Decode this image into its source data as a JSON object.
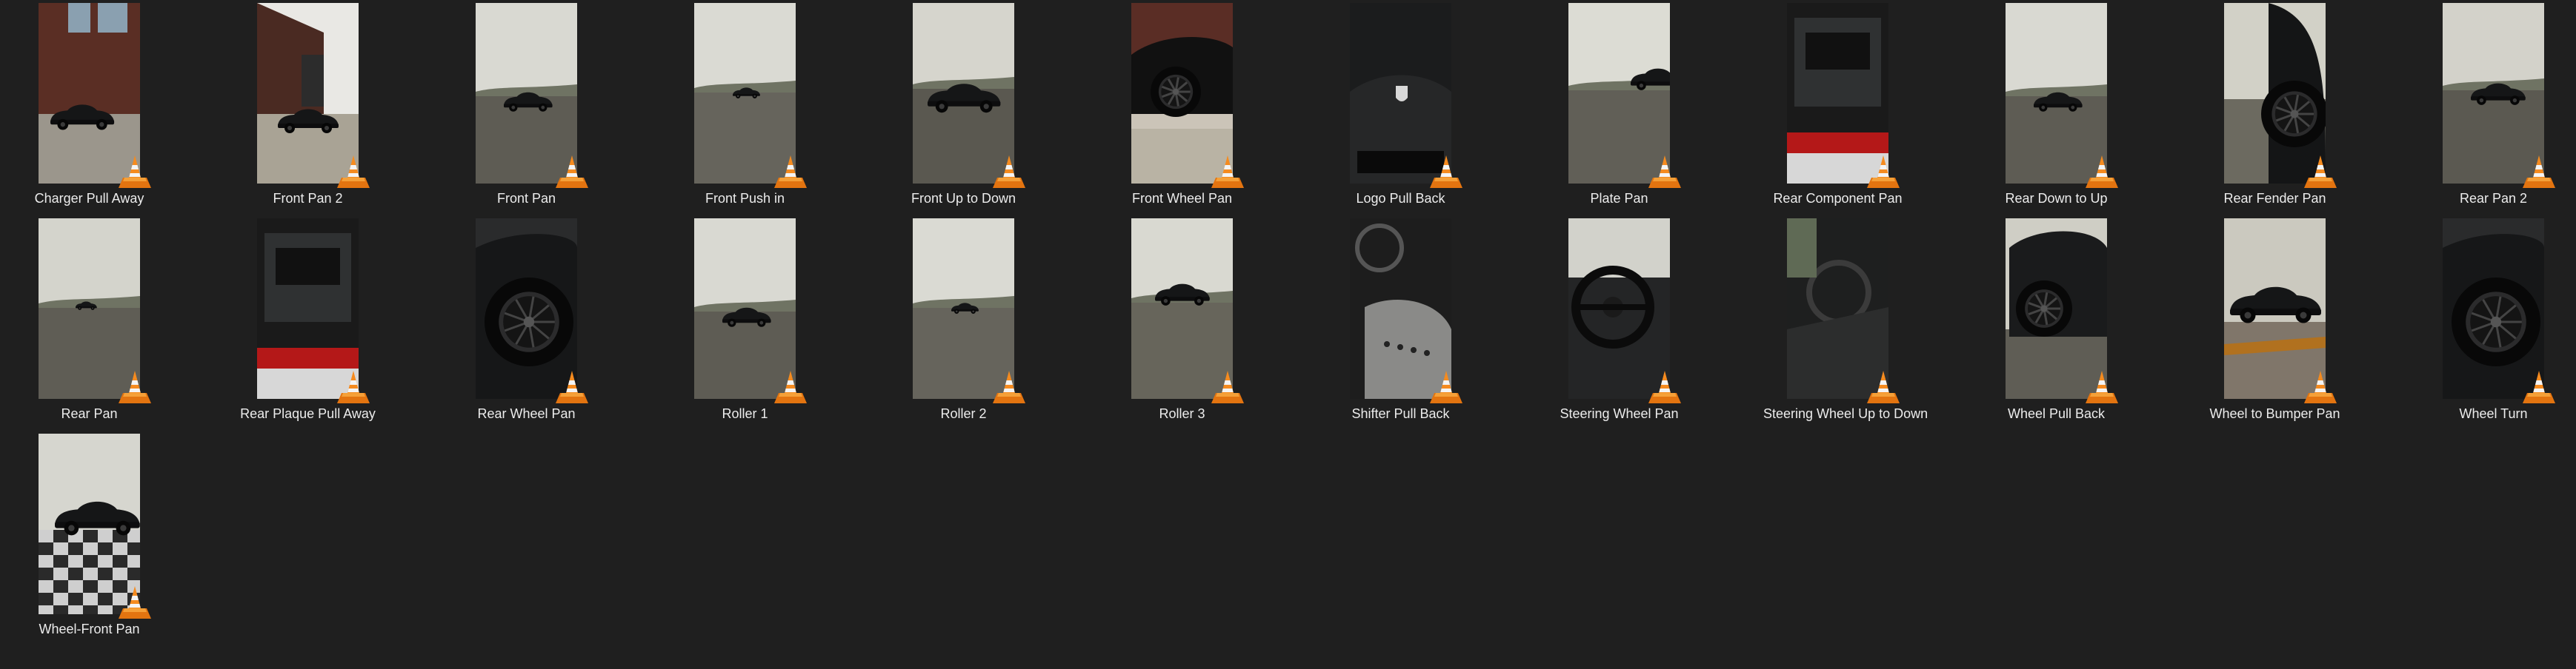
{
  "view": {
    "type": "large-icons",
    "file_icon": "vlc-cone-icon",
    "colors": {
      "background": "#1f1f1f",
      "label_text": "#ececec",
      "cone_orange": "#f58b1f",
      "cone_white": "#f4f4f4"
    }
  },
  "files": [
    {
      "name": "Charger Pull Away",
      "thumb": "building-left"
    },
    {
      "name": "Front Pan 2",
      "thumb": "building-right"
    },
    {
      "name": "Front Pan",
      "thumb": "field-car-mid"
    },
    {
      "name": "Front Push in",
      "thumb": "field-car-far"
    },
    {
      "name": "Front Up to Down",
      "thumb": "field-car-near"
    },
    {
      "name": "Front Wheel Pan",
      "thumb": "wheel-building"
    },
    {
      "name": "Logo Pull Back",
      "thumb": "dark-logo"
    },
    {
      "name": "Plate Pan",
      "thumb": "field-car-right"
    },
    {
      "name": "Rear Component Pan",
      "thumb": "engine-bay"
    },
    {
      "name": "Rear Down to Up",
      "thumb": "field-car-mid"
    },
    {
      "name": "Rear Fender Pan",
      "thumb": "fender-closeup"
    },
    {
      "name": "Rear Pan 2",
      "thumb": "field-car-rear"
    },
    {
      "name": "Rear Pan",
      "thumb": "field-car-tiny"
    },
    {
      "name": "Rear Plaque Pull Away",
      "thumb": "engine-bay"
    },
    {
      "name": "Rear Wheel Pan",
      "thumb": "wheel-closeup"
    },
    {
      "name": "Roller 1",
      "thumb": "field-car-mid"
    },
    {
      "name": "Roller 2",
      "thumb": "field-car-far"
    },
    {
      "name": "Roller 3",
      "thumb": "field-car-side"
    },
    {
      "name": "Shifter Pull Back",
      "thumb": "interior-seat"
    },
    {
      "name": "Steering Wheel Pan",
      "thumb": "steering-wheel"
    },
    {
      "name": "Steering Wheel Up to Down",
      "thumb": "interior-dark"
    },
    {
      "name": "Wheel Pull Back",
      "thumb": "wheel-mid"
    },
    {
      "name": "Wheel to Bumper Pan",
      "thumb": "car-track"
    },
    {
      "name": "Wheel Turn",
      "thumb": "wheel-closeup"
    },
    {
      "name": "Wheel-Front Pan",
      "thumb": "car-checker"
    }
  ]
}
